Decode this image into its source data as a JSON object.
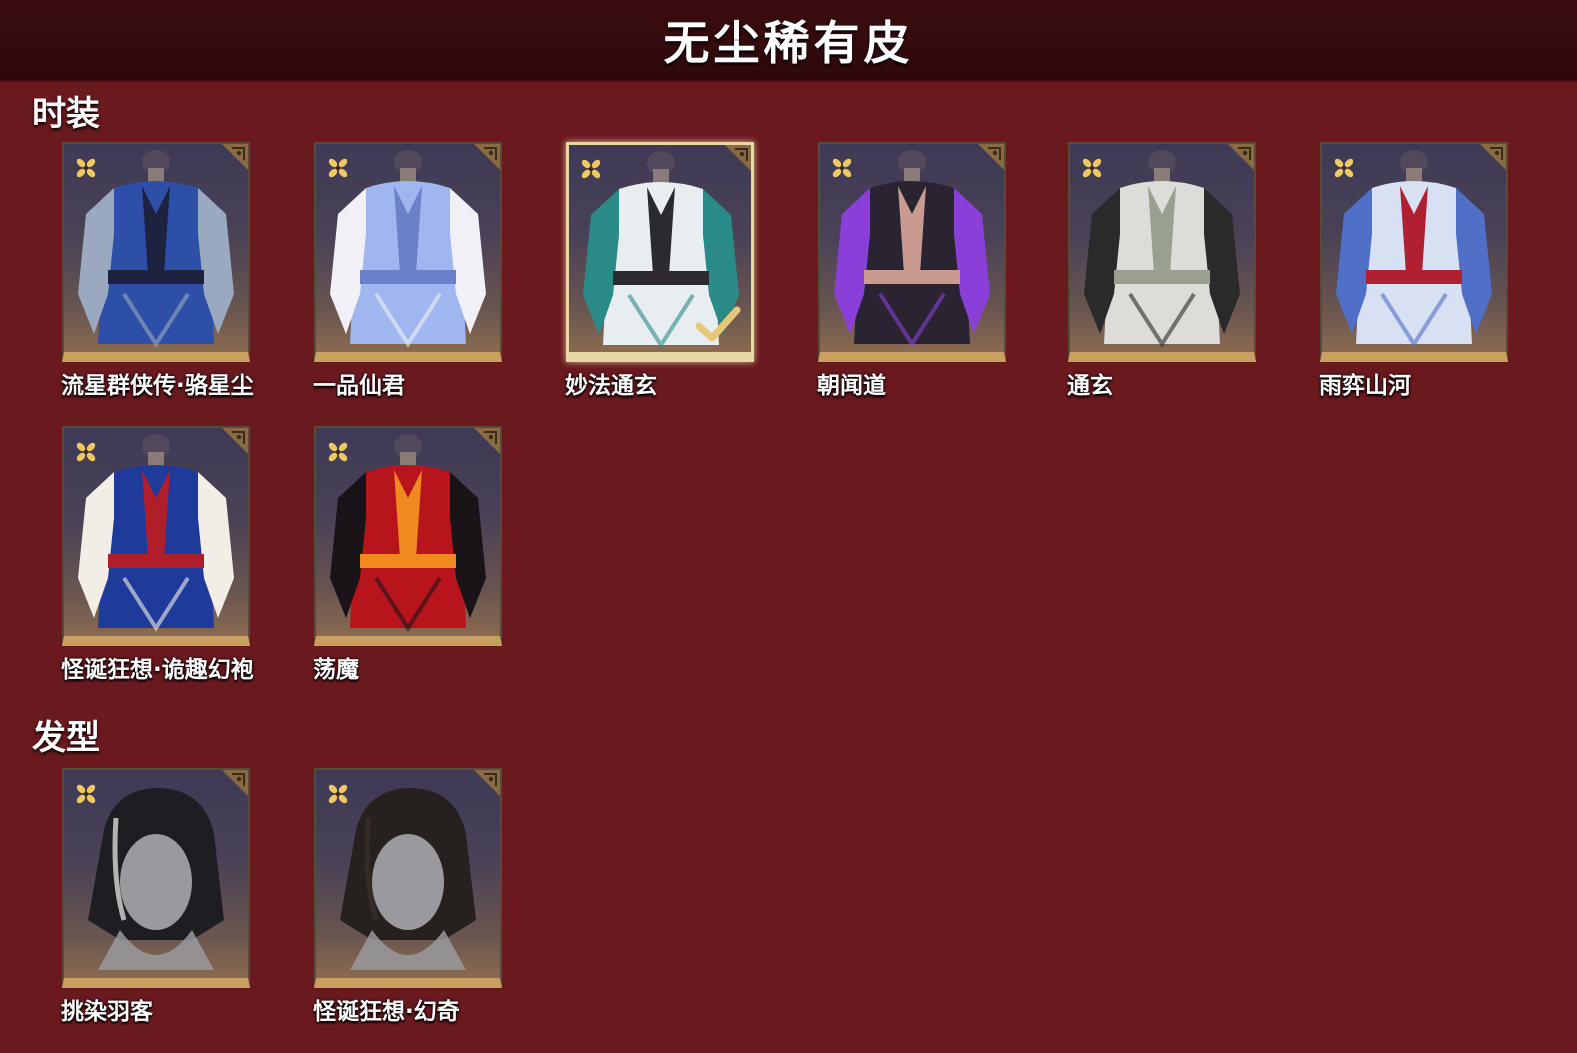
{
  "header": {
    "title": "无尘稀有皮"
  },
  "sections": {
    "outfits": {
      "title": "时装",
      "items": [
        {
          "name": "流星群侠传·骆星尘",
          "selected": false,
          "palette": [
            "#2d4fa8",
            "#9aa8c0",
            "#1c2240"
          ]
        },
        {
          "name": "一品仙君",
          "selected": false,
          "palette": [
            "#9fb6ee",
            "#f0f0f6",
            "#6a80c8"
          ]
        },
        {
          "name": "妙法通玄",
          "selected": true,
          "palette": [
            "#e8eef0",
            "#2a8a88",
            "#2a2a30"
          ]
        },
        {
          "name": "朝闻道",
          "selected": false,
          "palette": [
            "#2a2432",
            "#8a3fd8",
            "#c89a90"
          ]
        },
        {
          "name": "通玄",
          "selected": false,
          "palette": [
            "#dcdcd8",
            "#2a2a2a",
            "#9aa090"
          ]
        },
        {
          "name": "雨弈山河",
          "selected": false,
          "palette": [
            "#d8e0f4",
            "#5070c8",
            "#b02030"
          ]
        },
        {
          "name": "怪诞狂想·诡趣幻袍",
          "selected": false,
          "palette": [
            "#1e3a9a",
            "#f2eee6",
            "#b01e2a"
          ]
        },
        {
          "name": "荡魔",
          "selected": false,
          "palette": [
            "#b8141c",
            "#1a1418",
            "#f08a20"
          ]
        }
      ]
    },
    "hairstyles": {
      "title": "发型",
      "items": [
        {
          "name": "挑染羽客",
          "selected": false,
          "palette": [
            "#1e1e22",
            "#d8d8d8",
            "#9a9a9e"
          ]
        },
        {
          "name": "怪诞狂想·幻奇",
          "selected": false,
          "palette": [
            "#26201e",
            "#3a302c",
            "#9a9a9e"
          ]
        }
      ]
    }
  },
  "icons": {
    "rarity": "gold-flower-icon",
    "corner": "corner-tag-icon",
    "selected": "checkmark-icon"
  },
  "colors": {
    "background": "#6a1a1f",
    "header": "#330b0e",
    "card_accent": "#caa061",
    "rarity_gold": "#f0c860"
  }
}
